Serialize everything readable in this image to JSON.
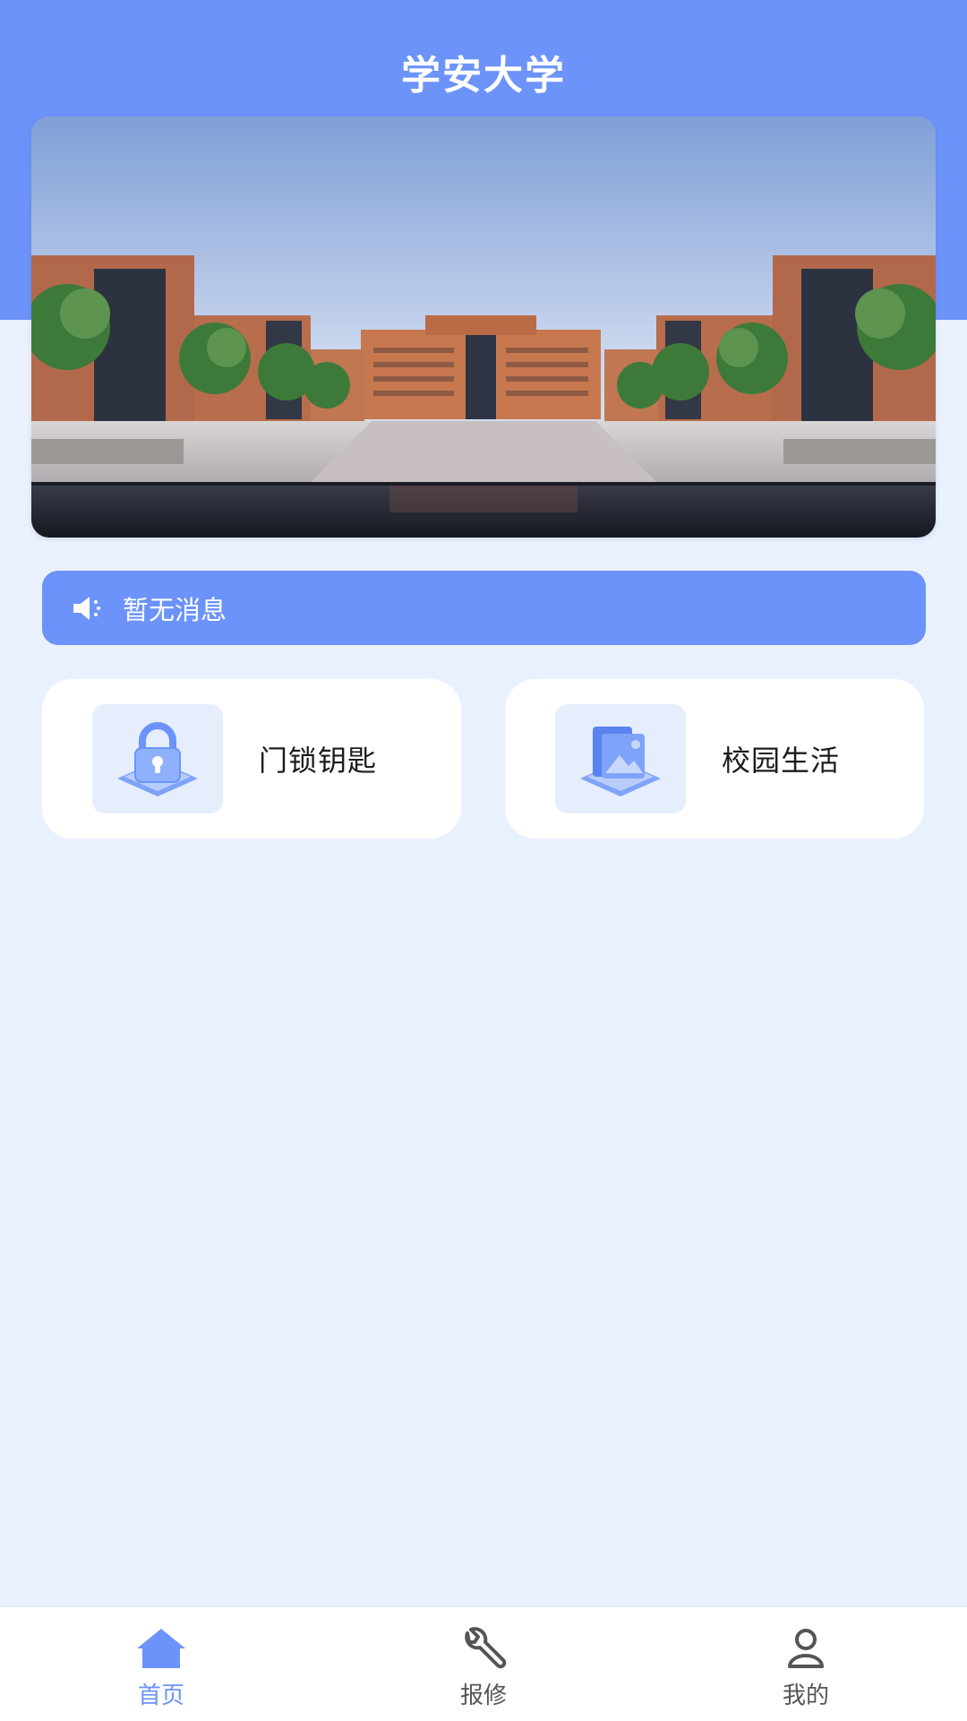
{
  "app": {
    "title": "学安大学"
  },
  "banner": {
    "alt": "campus-illustration"
  },
  "notice": {
    "icon": "speaker-icon",
    "text": "暂无消息"
  },
  "features": [
    {
      "label": "门锁钥匙",
      "icon": "padlock-icon"
    },
    {
      "label": "校园生活",
      "icon": "gallery-icon"
    }
  ],
  "tabbar": {
    "items": [
      {
        "label": "首页",
        "icon": "home-icon",
        "active": true
      },
      {
        "label": "报修",
        "icon": "wrench-icon",
        "active": false
      },
      {
        "label": "我的",
        "icon": "user-icon",
        "active": false
      }
    ]
  },
  "colors": {
    "primary": "#6C93F9",
    "background": "#EAF1FE",
    "card": "#FFFFFF",
    "icon_tile": "#E6EEFD"
  }
}
